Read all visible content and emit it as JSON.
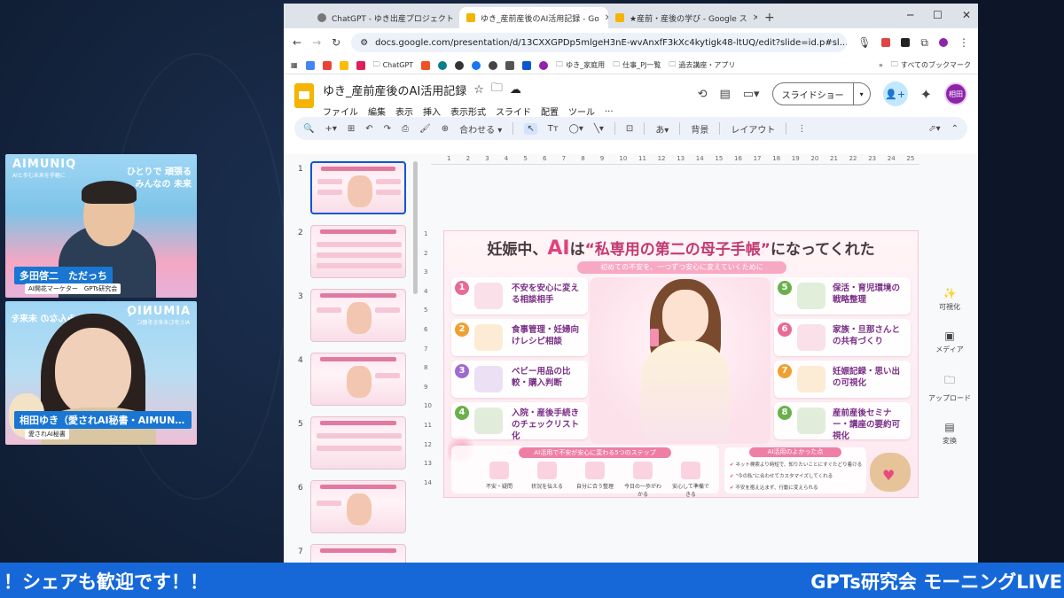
{
  "browser": {
    "tabs": [
      {
        "label": "ChatGPT - ゆき出産プロジェクト",
        "favicon": "chatgpt-icon",
        "color": "#777777"
      },
      {
        "label": "ゆき_産前産後のAI活用記録 - Go",
        "favicon": "slides-icon",
        "color": "#f4b400"
      },
      {
        "label": "★産前・産後の学び - Google ス",
        "favicon": "slides-icon",
        "color": "#f4b400"
      }
    ],
    "url": "docs.google.com/presentation/d/13CXXGPDp5mlgeH3nE-wvAnxfF3kXc4kytigk48-ltUQ/edit?slide=id.p#sl...",
    "bookmarks": [
      "ChatGPT",
      "ゆき_家庭用",
      "仕事_PJ一覧",
      "過去講座・アプリ"
    ],
    "bookmarks_all": "すべてのブックマーク"
  },
  "slides_app": {
    "doc_title": "ゆき_産前産後のAI活用記録",
    "menus": [
      "ファイル",
      "編集",
      "表示",
      "挿入",
      "表示形式",
      "スライド",
      "配置",
      "ツール",
      "..."
    ],
    "slideshow_label": "スライドショー",
    "avatar_label": "相田",
    "toolbar": {
      "fit": "合わせる",
      "bg": "背景",
      "layout": "レイアウト"
    },
    "slide_numbers": [
      "1",
      "2",
      "3",
      "4",
      "5",
      "6",
      "7"
    ],
    "ruler_h": [
      "1",
      "2",
      "3",
      "4",
      "5",
      "6",
      "7",
      "8",
      "9",
      "10",
      "11",
      "12",
      "13",
      "14",
      "15",
      "16",
      "17",
      "18",
      "19",
      "20",
      "21",
      "22",
      "23",
      "24",
      "25"
    ],
    "ruler_v": [
      "1",
      "2",
      "3",
      "4",
      "5",
      "6",
      "7",
      "8",
      "9",
      "10",
      "11",
      "12",
      "13",
      "14"
    ],
    "side_panel": [
      "可視化",
      "メディア",
      "アップロード",
      "変換"
    ]
  },
  "slide": {
    "title_pre": "妊娠中、",
    "title_ai": "AI",
    "title_mid": "は",
    "title_pink": "“私専用の第二の母子手帳”",
    "title_post": "になってくれた",
    "subtitle": "初めての不安を、一つずつ安心に変えていくために",
    "cards_left": [
      {
        "num": "1",
        "text": "不安を安心に変える相談相手",
        "color": "#e86a95"
      },
      {
        "num": "2",
        "text": "食事管理・妊婦向けレシピ相談",
        "color": "#f0a030"
      },
      {
        "num": "3",
        "text": "ベビー用品の比較・購入判断",
        "color": "#a06ad0"
      },
      {
        "num": "4",
        "text": "入院・産後手続きのチェックリスト化",
        "color": "#6ab04c"
      }
    ],
    "cards_right": [
      {
        "num": "5",
        "text": "保活・育児環境の戦略整理",
        "color": "#6ab04c"
      },
      {
        "num": "6",
        "text": "家族・旦那さんとの共有づくり",
        "color": "#e86a95"
      },
      {
        "num": "7",
        "text": "妊娠記録・思い出の可視化",
        "color": "#f0a030"
      },
      {
        "num": "8",
        "text": "産前産後セミナー・講座の要約可視化",
        "color": "#6ab04c"
      }
    ],
    "steps_title": "AI活用で不安が安心に変わる5つのステップ",
    "steps": [
      "不安・疑問",
      "状況を伝える",
      "自分に合う整理",
      "今日の一歩がわかる",
      "安心して準備できる"
    ],
    "merit_title": "AI活用のよかった点",
    "merits": [
      "ネット検索より時短で、知りたいことにすぐたどり着ける",
      "“今の私”に合わせてカスタマイズしてくれる",
      "不安を抱え込まず、行動に変えられる"
    ]
  },
  "participants": [
    {
      "name": "多田啓二　ただっち",
      "role": "AI開花マーケター　GPTs研究会",
      "brand": "AIMUNIQ",
      "brand_sub": "AIと歩む未来を手軽に",
      "tagline": "ひとりで 頑張る\nみんなの 未来"
    },
    {
      "name": "相田ゆき（愛されAI秘書・AIMUNIQ...",
      "role": "愛されAI秘書",
      "brand": "AIMUNIQ",
      "brand_sub": "AIと歩む未来を手軽に",
      "tagline": "みんなの 未来を"
    }
  ],
  "ticker": {
    "left": "！シェアも歓迎です！！",
    "right": "GPTs研究会 モーニングLIVE"
  }
}
